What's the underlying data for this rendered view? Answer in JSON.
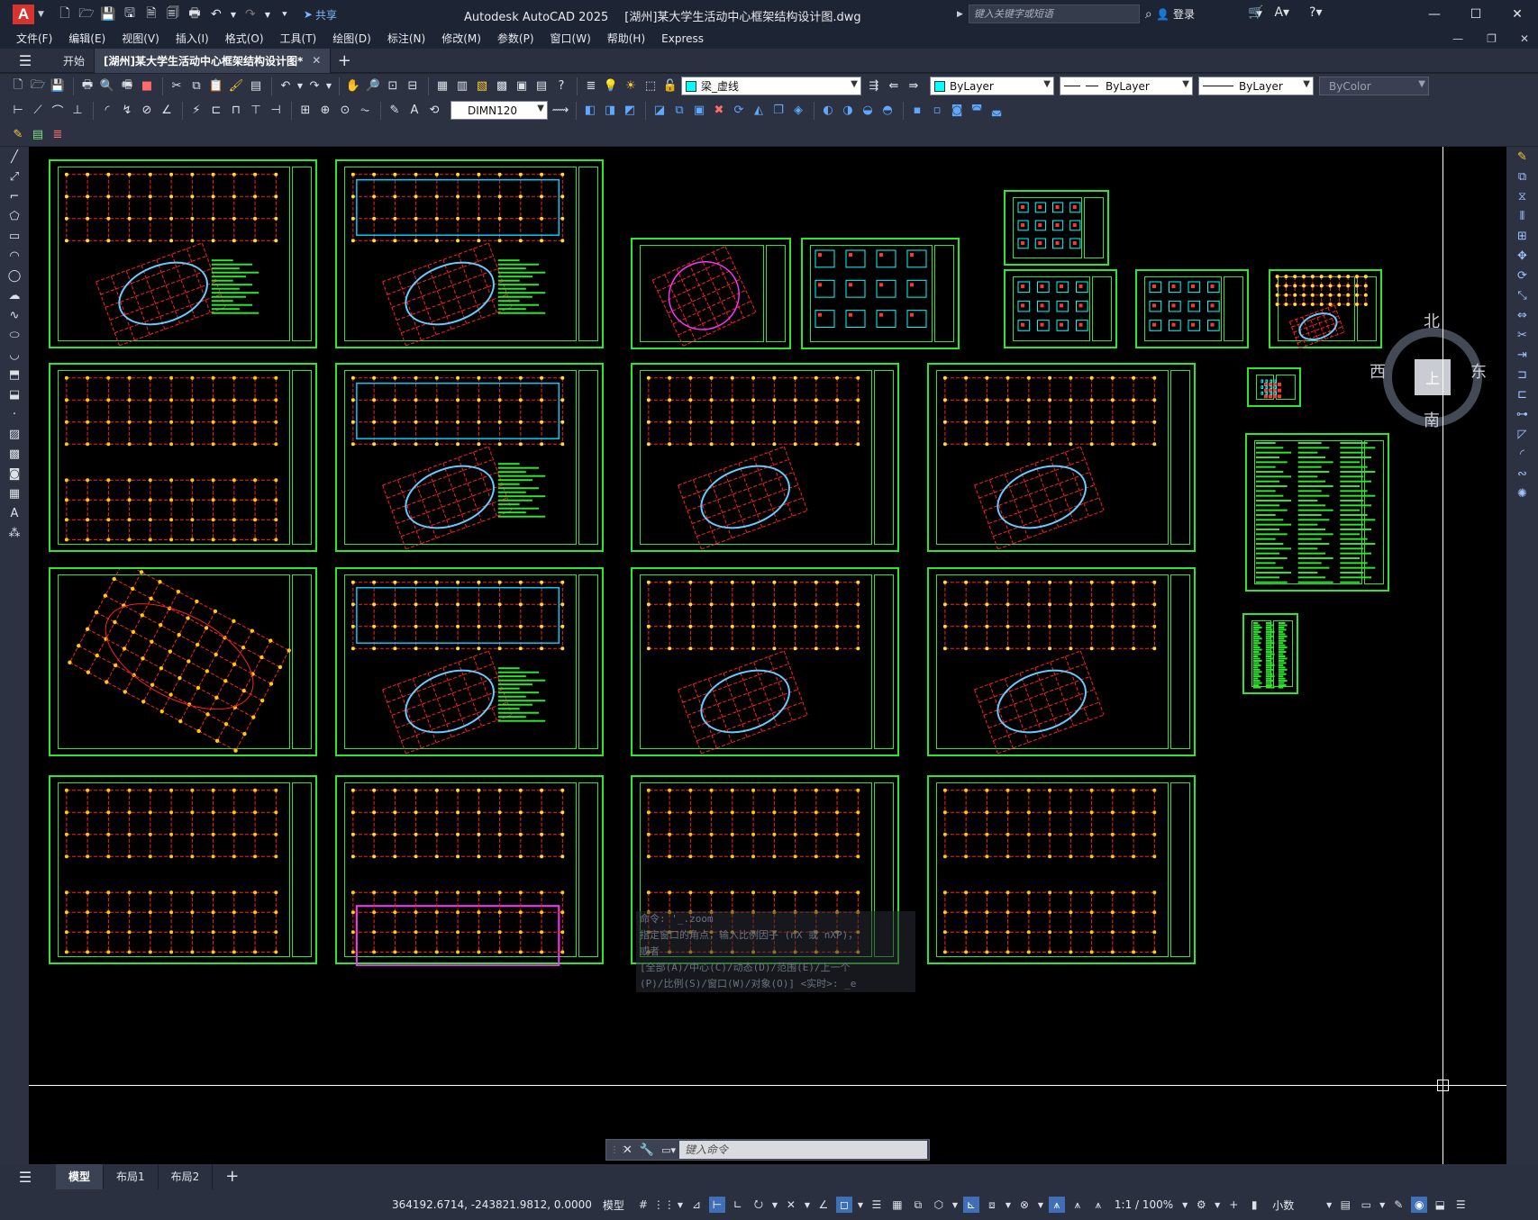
{
  "app": {
    "logo_letter": "A",
    "title": "Autodesk AutoCAD 2025",
    "document": "[湖州]某大学生活动中心框架结构设计图.dwg",
    "share_label": "共享",
    "search_placeholder": "键入关键字或短语",
    "login_label": "登录"
  },
  "menu": [
    "文件(F)",
    "编辑(E)",
    "视图(V)",
    "插入(I)",
    "格式(O)",
    "工具(T)",
    "绘图(D)",
    "标注(N)",
    "修改(M)",
    "参数(P)",
    "窗口(W)",
    "帮助(H)",
    "Express"
  ],
  "tabs": {
    "start": "开始",
    "drawing": "[湖州]某大学生活动中心框架结构设计图*"
  },
  "properties": {
    "layer": "梁_虚线",
    "color": "ByLayer",
    "linetype": "ByLayer",
    "lineweight": "ByLayer",
    "plotstyle": "ByColor",
    "dimstyle": "DIMN120",
    "layer_color": "#00ffff",
    "color_swatch": "#00ffff"
  },
  "viewcube": {
    "north": "北",
    "south": "南",
    "east": "东",
    "west": "西",
    "face": "上"
  },
  "command_history": [
    "命令: '_.zoom",
    "指定窗口的角点，输入比例因子 (nX 或 nXP)，",
    "或者",
    "[全部(A)/中心(C)/动态(D)/范围(E)/上一个",
    "(P)/比例(S)/窗口(W)/对象(O)] <实时>: _e"
  ],
  "command_placeholder": "键入命令",
  "layout_tabs": [
    "模型",
    "布局1",
    "布局2"
  ],
  "status": {
    "coords": "364192.6714, -243821.9812, 0.0000",
    "space": "模型",
    "scale": "1:1 / 100%",
    "units": "小数"
  },
  "colors": {
    "canvas_bg": "#000000",
    "frame": "#2ee52e",
    "accent": "#3f6fb6"
  }
}
